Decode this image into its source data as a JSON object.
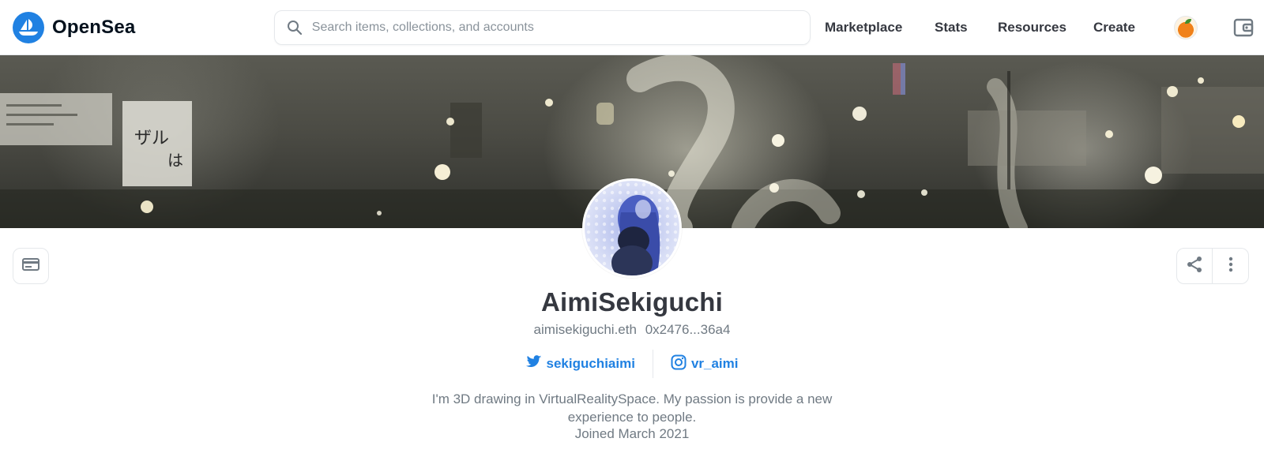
{
  "header": {
    "brand": "OpenSea",
    "search_placeholder": "Search items, collections, and accounts",
    "nav": [
      "Marketplace",
      "Stats",
      "Resources",
      "Create"
    ]
  },
  "profile": {
    "username": "AimiSekiguchi",
    "ens": "aimisekiguchi.eth",
    "address": "0x2476...36a4",
    "twitter": "sekiguchiaimi",
    "instagram": "vr_aimi",
    "bio": "I'm 3D drawing in VirtualRealitySpace. My passion is provide a new experience to people.",
    "joined": "Joined March 2021"
  },
  "colors": {
    "accent": "#2081e2",
    "text_primary": "#353840",
    "text_secondary": "#707a83",
    "border": "#e5e8eb"
  },
  "icons": {
    "logo": "opensea-logo-icon",
    "search": "search-icon",
    "account": "account-avatar",
    "wallet": "wallet-icon",
    "banner_toggle": "banner-card-icon",
    "share": "share-icon",
    "more": "more-vertical-icon",
    "twitter": "twitter-icon",
    "instagram": "instagram-icon"
  }
}
